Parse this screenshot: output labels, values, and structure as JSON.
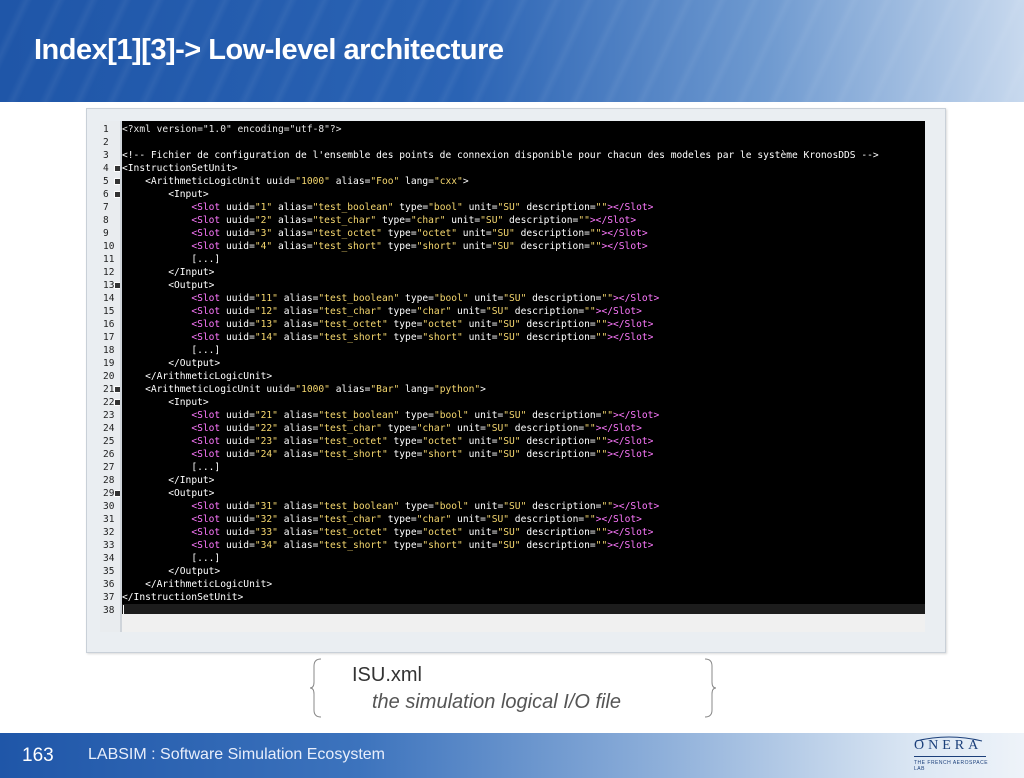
{
  "header": {
    "title": "Index[1][3]-> Low-level architecture"
  },
  "editor": {
    "lines": [
      [
        [
          "pi",
          "<?xml version=\"1.0\" encoding=\"utf-8\"?>"
        ]
      ],
      [],
      [
        [
          "com",
          "<!-- Fichier de configuration de l'ensemble des points de connexion disponible pour chacun des modeles par le système KronosDDS -->"
        ]
      ],
      [
        [
          "tag",
          "<InstructionSetUnit>"
        ]
      ],
      [
        [
          "sp",
          "    "
        ],
        [
          "tag",
          "<ArithmeticLogicUnit "
        ],
        [
          "attr",
          "uuid="
        ],
        [
          "val",
          "\"1000\""
        ],
        [
          "attr",
          " alias="
        ],
        [
          "val",
          "\"Foo\""
        ],
        [
          "attr",
          " lang="
        ],
        [
          "val",
          "\"cxx\""
        ],
        [
          "tag",
          ">"
        ]
      ],
      [
        [
          "sp",
          "        "
        ],
        [
          "tag",
          "<Input>"
        ]
      ],
      [
        [
          "sp",
          "            "
        ],
        [
          "slot",
          "<Slot "
        ],
        [
          "attr",
          "uuid="
        ],
        [
          "val",
          "\"1\""
        ],
        [
          "attr",
          " alias="
        ],
        [
          "val",
          "\"test_boolean\""
        ],
        [
          "attr",
          " type="
        ],
        [
          "val",
          "\"bool\""
        ],
        [
          "attr",
          " unit="
        ],
        [
          "val",
          "\"SU\""
        ],
        [
          "attr",
          " description="
        ],
        [
          "val",
          "\"\""
        ],
        [
          "slot",
          "></Slot>"
        ]
      ],
      [
        [
          "sp",
          "            "
        ],
        [
          "slot",
          "<Slot "
        ],
        [
          "attr",
          "uuid="
        ],
        [
          "val",
          "\"2\""
        ],
        [
          "attr",
          " alias="
        ],
        [
          "val",
          "\"test_char\""
        ],
        [
          "attr",
          " type="
        ],
        [
          "val",
          "\"char\""
        ],
        [
          "attr",
          " unit="
        ],
        [
          "val",
          "\"SU\""
        ],
        [
          "attr",
          " description="
        ],
        [
          "val",
          "\"\""
        ],
        [
          "slot",
          "></Slot>"
        ]
      ],
      [
        [
          "sp",
          "            "
        ],
        [
          "slot",
          "<Slot "
        ],
        [
          "attr",
          "uuid="
        ],
        [
          "val",
          "\"3\""
        ],
        [
          "attr",
          " alias="
        ],
        [
          "val",
          "\"test_octet\""
        ],
        [
          "attr",
          " type="
        ],
        [
          "val",
          "\"octet\""
        ],
        [
          "attr",
          " unit="
        ],
        [
          "val",
          "\"SU\""
        ],
        [
          "attr",
          " description="
        ],
        [
          "val",
          "\"\""
        ],
        [
          "slot",
          "></Slot>"
        ]
      ],
      [
        [
          "sp",
          "            "
        ],
        [
          "slot",
          "<Slot "
        ],
        [
          "attr",
          "uuid="
        ],
        [
          "val",
          "\"4\""
        ],
        [
          "attr",
          " alias="
        ],
        [
          "val",
          "\"test_short\""
        ],
        [
          "attr",
          " type="
        ],
        [
          "val",
          "\"short\""
        ],
        [
          "attr",
          " unit="
        ],
        [
          "val",
          "\"SU\""
        ],
        [
          "attr",
          " description="
        ],
        [
          "val",
          "\"\""
        ],
        [
          "slot",
          "></Slot>"
        ]
      ],
      [
        [
          "sp",
          "            "
        ],
        [
          "tag",
          "[...]"
        ]
      ],
      [
        [
          "sp",
          "        "
        ],
        [
          "tag",
          "</Input>"
        ]
      ],
      [
        [
          "sp",
          "        "
        ],
        [
          "tag",
          "<Output>"
        ]
      ],
      [
        [
          "sp",
          "            "
        ],
        [
          "slot",
          "<Slot "
        ],
        [
          "attr",
          "uuid="
        ],
        [
          "val",
          "\"11\""
        ],
        [
          "attr",
          " alias="
        ],
        [
          "val",
          "\"test_boolean\""
        ],
        [
          "attr",
          " type="
        ],
        [
          "val",
          "\"bool\""
        ],
        [
          "attr",
          " unit="
        ],
        [
          "val",
          "\"SU\""
        ],
        [
          "attr",
          " description="
        ],
        [
          "val",
          "\"\""
        ],
        [
          "slot",
          "></Slot>"
        ]
      ],
      [
        [
          "sp",
          "            "
        ],
        [
          "slot",
          "<Slot "
        ],
        [
          "attr",
          "uuid="
        ],
        [
          "val",
          "\"12\""
        ],
        [
          "attr",
          " alias="
        ],
        [
          "val",
          "\"test_char\""
        ],
        [
          "attr",
          " type="
        ],
        [
          "val",
          "\"char\""
        ],
        [
          "attr",
          " unit="
        ],
        [
          "val",
          "\"SU\""
        ],
        [
          "attr",
          " description="
        ],
        [
          "val",
          "\"\""
        ],
        [
          "slot",
          "></Slot>"
        ]
      ],
      [
        [
          "sp",
          "            "
        ],
        [
          "slot",
          "<Slot "
        ],
        [
          "attr",
          "uuid="
        ],
        [
          "val",
          "\"13\""
        ],
        [
          "attr",
          " alias="
        ],
        [
          "val",
          "\"test_octet\""
        ],
        [
          "attr",
          " type="
        ],
        [
          "val",
          "\"octet\""
        ],
        [
          "attr",
          " unit="
        ],
        [
          "val",
          "\"SU\""
        ],
        [
          "attr",
          " description="
        ],
        [
          "val",
          "\"\""
        ],
        [
          "slot",
          "></Slot>"
        ]
      ],
      [
        [
          "sp",
          "            "
        ],
        [
          "slot",
          "<Slot "
        ],
        [
          "attr",
          "uuid="
        ],
        [
          "val",
          "\"14\""
        ],
        [
          "attr",
          " alias="
        ],
        [
          "val",
          "\"test_short\""
        ],
        [
          "attr",
          " type="
        ],
        [
          "val",
          "\"short\""
        ],
        [
          "attr",
          " unit="
        ],
        [
          "val",
          "\"SU\""
        ],
        [
          "attr",
          " description="
        ],
        [
          "val",
          "\"\""
        ],
        [
          "slot",
          "></Slot>"
        ]
      ],
      [
        [
          "sp",
          "            "
        ],
        [
          "tag",
          "[...]"
        ]
      ],
      [
        [
          "sp",
          "        "
        ],
        [
          "tag",
          "</Output>"
        ]
      ],
      [
        [
          "sp",
          "    "
        ],
        [
          "tag",
          "</ArithmeticLogicUnit>"
        ]
      ],
      [
        [
          "sp",
          "    "
        ],
        [
          "tag",
          "<ArithmeticLogicUnit "
        ],
        [
          "attr",
          "uuid="
        ],
        [
          "val",
          "\"1000\""
        ],
        [
          "attr",
          " alias="
        ],
        [
          "val",
          "\"Bar\""
        ],
        [
          "attr",
          " lang="
        ],
        [
          "val",
          "\"python\""
        ],
        [
          "tag",
          ">"
        ]
      ],
      [
        [
          "sp",
          "        "
        ],
        [
          "tag",
          "<Input>"
        ]
      ],
      [
        [
          "sp",
          "            "
        ],
        [
          "slot",
          "<Slot "
        ],
        [
          "attr",
          "uuid="
        ],
        [
          "val",
          "\"21\""
        ],
        [
          "attr",
          " alias="
        ],
        [
          "val",
          "\"test_boolean\""
        ],
        [
          "attr",
          " type="
        ],
        [
          "val",
          "\"bool\""
        ],
        [
          "attr",
          " unit="
        ],
        [
          "val",
          "\"SU\""
        ],
        [
          "attr",
          " description="
        ],
        [
          "val",
          "\"\""
        ],
        [
          "slot",
          "></Slot>"
        ]
      ],
      [
        [
          "sp",
          "            "
        ],
        [
          "slot",
          "<Slot "
        ],
        [
          "attr",
          "uuid="
        ],
        [
          "val",
          "\"22\""
        ],
        [
          "attr",
          " alias="
        ],
        [
          "val",
          "\"test_char\""
        ],
        [
          "attr",
          " type="
        ],
        [
          "val",
          "\"char\""
        ],
        [
          "attr",
          " unit="
        ],
        [
          "val",
          "\"SU\""
        ],
        [
          "attr",
          " description="
        ],
        [
          "val",
          "\"\""
        ],
        [
          "slot",
          "></Slot>"
        ]
      ],
      [
        [
          "sp",
          "            "
        ],
        [
          "slot",
          "<Slot "
        ],
        [
          "attr",
          "uuid="
        ],
        [
          "val",
          "\"23\""
        ],
        [
          "attr",
          " alias="
        ],
        [
          "val",
          "\"test_octet\""
        ],
        [
          "attr",
          " type="
        ],
        [
          "val",
          "\"octet\""
        ],
        [
          "attr",
          " unit="
        ],
        [
          "val",
          "\"SU\""
        ],
        [
          "attr",
          " description="
        ],
        [
          "val",
          "\"\""
        ],
        [
          "slot",
          "></Slot>"
        ]
      ],
      [
        [
          "sp",
          "            "
        ],
        [
          "slot",
          "<Slot "
        ],
        [
          "attr",
          "uuid="
        ],
        [
          "val",
          "\"24\""
        ],
        [
          "attr",
          " alias="
        ],
        [
          "val",
          "\"test_short\""
        ],
        [
          "attr",
          " type="
        ],
        [
          "val",
          "\"short\""
        ],
        [
          "attr",
          " unit="
        ],
        [
          "val",
          "\"SU\""
        ],
        [
          "attr",
          " description="
        ],
        [
          "val",
          "\"\""
        ],
        [
          "slot",
          "></Slot>"
        ]
      ],
      [
        [
          "sp",
          "            "
        ],
        [
          "tag",
          "[...]"
        ]
      ],
      [
        [
          "sp",
          "        "
        ],
        [
          "tag",
          "</Input>"
        ]
      ],
      [
        [
          "sp",
          "        "
        ],
        [
          "tag",
          "<Output>"
        ]
      ],
      [
        [
          "sp",
          "            "
        ],
        [
          "slot",
          "<Slot "
        ],
        [
          "attr",
          "uuid="
        ],
        [
          "val",
          "\"31\""
        ],
        [
          "attr",
          " alias="
        ],
        [
          "val",
          "\"test_boolean\""
        ],
        [
          "attr",
          " type="
        ],
        [
          "val",
          "\"bool\""
        ],
        [
          "attr",
          " unit="
        ],
        [
          "val",
          "\"SU\""
        ],
        [
          "attr",
          " description="
        ],
        [
          "val",
          "\"\""
        ],
        [
          "slot",
          "></Slot>"
        ]
      ],
      [
        [
          "sp",
          "            "
        ],
        [
          "slot",
          "<Slot "
        ],
        [
          "attr",
          "uuid="
        ],
        [
          "val",
          "\"32\""
        ],
        [
          "attr",
          " alias="
        ],
        [
          "val",
          "\"test_char\""
        ],
        [
          "attr",
          " type="
        ],
        [
          "val",
          "\"char\""
        ],
        [
          "attr",
          " unit="
        ],
        [
          "val",
          "\"SU\""
        ],
        [
          "attr",
          " description="
        ],
        [
          "val",
          "\"\""
        ],
        [
          "slot",
          "></Slot>"
        ]
      ],
      [
        [
          "sp",
          "            "
        ],
        [
          "slot",
          "<Slot "
        ],
        [
          "attr",
          "uuid="
        ],
        [
          "val",
          "\"33\""
        ],
        [
          "attr",
          " alias="
        ],
        [
          "val",
          "\"test_octet\""
        ],
        [
          "attr",
          " type="
        ],
        [
          "val",
          "\"octet\""
        ],
        [
          "attr",
          " unit="
        ],
        [
          "val",
          "\"SU\""
        ],
        [
          "attr",
          " description="
        ],
        [
          "val",
          "\"\""
        ],
        [
          "slot",
          "></Slot>"
        ]
      ],
      [
        [
          "sp",
          "            "
        ],
        [
          "slot",
          "<Slot "
        ],
        [
          "attr",
          "uuid="
        ],
        [
          "val",
          "\"34\""
        ],
        [
          "attr",
          " alias="
        ],
        [
          "val",
          "\"test_short\""
        ],
        [
          "attr",
          " type="
        ],
        [
          "val",
          "\"short\""
        ],
        [
          "attr",
          " unit="
        ],
        [
          "val",
          "\"SU\""
        ],
        [
          "attr",
          " description="
        ],
        [
          "val",
          "\"\""
        ],
        [
          "slot",
          "></Slot>"
        ]
      ],
      [
        [
          "sp",
          "            "
        ],
        [
          "tag",
          "[...]"
        ]
      ],
      [
        [
          "sp",
          "        "
        ],
        [
          "tag",
          "</Output>"
        ]
      ],
      [
        [
          "sp",
          "    "
        ],
        [
          "tag",
          "</ArithmeticLogicUnit>"
        ]
      ],
      [
        [
          "tag",
          "</InstructionSetUnit>"
        ]
      ],
      []
    ],
    "fold_lines": [
      4,
      5,
      6,
      13,
      21,
      22,
      29
    ]
  },
  "caption": {
    "filename": "ISU.xml",
    "description": "the simulation logical I/O  file"
  },
  "footer": {
    "page_number": "163",
    "text": "LABSIM : Software Simulation Ecosystem",
    "logo_word": "ONERA",
    "logo_tagline": "THE FRENCH AEROSPACE LAB"
  }
}
